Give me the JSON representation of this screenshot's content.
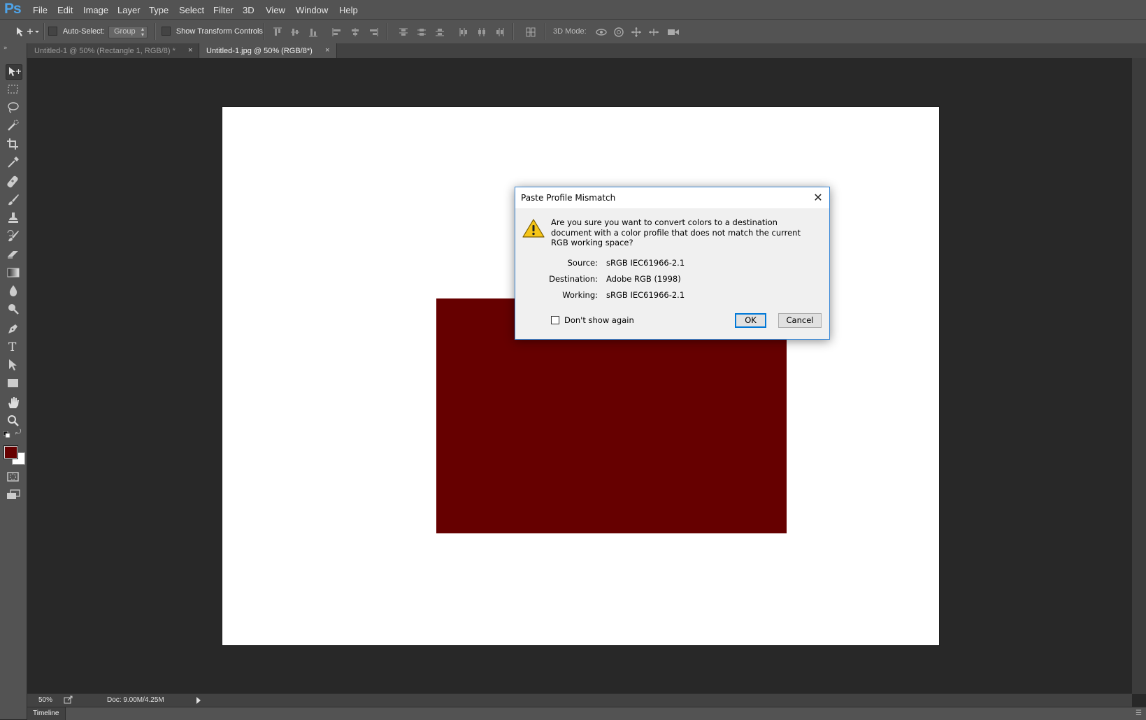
{
  "app": {
    "logo": "Ps"
  },
  "menu": [
    "File",
    "Edit",
    "Image",
    "Layer",
    "Type",
    "Select",
    "Filter",
    "3D",
    "View",
    "Window",
    "Help"
  ],
  "options_bar": {
    "auto_select_label": "Auto-Select:",
    "auto_select_value": "Group",
    "show_transform_label": "Show Transform Controls",
    "mode_label": "3D Mode:"
  },
  "tabs": [
    {
      "label": "Untitled-1 @ 50% (Rectangle 1, RGB/8) *",
      "active": false
    },
    {
      "label": "Untitled-1.jpg @ 50% (RGB/8*)",
      "active": true
    }
  ],
  "tools": [
    "move-tool",
    "marquee-tool",
    "lasso-tool",
    "quick-selection-tool",
    "crop-tool",
    "eyedropper-tool",
    "healing-brush-tool",
    "brush-tool",
    "clone-stamp-tool",
    "history-brush-tool",
    "eraser-tool",
    "gradient-tool",
    "blur-tool",
    "dodge-tool",
    "pen-tool",
    "type-tool",
    "path-selection-tool",
    "rectangle-tool",
    "hand-tool",
    "zoom-tool"
  ],
  "colors": {
    "foreground": "#660000",
    "background": "#ffffff",
    "shape_fill": "#660000"
  },
  "status": {
    "zoom": "50%",
    "doc": "Doc: 9.00M/4.25M"
  },
  "timeline": {
    "label": "Timeline"
  },
  "dialog": {
    "title": "Paste Profile Mismatch",
    "message": "Are you sure you want to convert colors to a destination document with a color profile that does not match the current RGB working space?",
    "source_label": "Source:",
    "source_value": "sRGB IEC61966-2.1",
    "destination_label": "Destination:",
    "destination_value": "Adobe RGB (1998)",
    "working_label": "Working:",
    "working_value": "sRGB IEC61966-2.1",
    "dont_show_label": "Don't show again",
    "ok_label": "OK",
    "cancel_label": "Cancel",
    "warning_icon": "warning-triangle-icon"
  }
}
